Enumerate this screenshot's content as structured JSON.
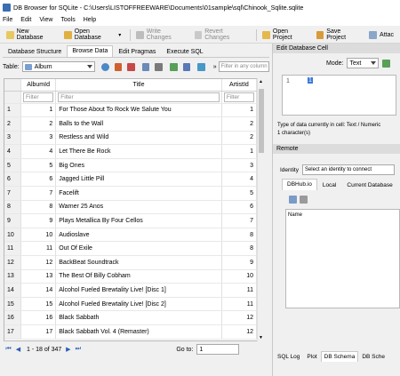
{
  "window": {
    "title": "DB Browser for SQLite - C:\\Users\\LISTOFFREEWARE\\Documents\\01sample\\sql\\Chinook_Sqlite.sqlite"
  },
  "menu": [
    "File",
    "Edit",
    "View",
    "Tools",
    "Help"
  ],
  "toolbar": {
    "new_db": "New Database",
    "open_db": "Open Database",
    "write": "Write Changes",
    "revert": "Revert Changes",
    "open_project": "Open Project",
    "save_project": "Save Project",
    "attach": "Attac"
  },
  "main_tabs": [
    "Database Structure",
    "Browse Data",
    "Edit Pragmas",
    "Execute SQL"
  ],
  "browse": {
    "table_label": "Table:",
    "table_value": "Album",
    "filter_placeholder": "Filter in any column"
  },
  "columns": [
    "AlbumId",
    "Title",
    "ArtistId"
  ],
  "filter_label": "Filter",
  "rows": [
    {
      "n": "1",
      "id": "1",
      "title": "For Those About To Rock We Salute You",
      "artist": "1"
    },
    {
      "n": "2",
      "id": "2",
      "title": "Balls to the Wall",
      "artist": "2"
    },
    {
      "n": "3",
      "id": "3",
      "title": "Restless and Wild",
      "artist": "2"
    },
    {
      "n": "4",
      "id": "4",
      "title": "Let There Be Rock",
      "artist": "1"
    },
    {
      "n": "5",
      "id": "5",
      "title": "Big Ones",
      "artist": "3"
    },
    {
      "n": "6",
      "id": "6",
      "title": "Jagged Little Pill",
      "artist": "4"
    },
    {
      "n": "7",
      "id": "7",
      "title": "Facelift",
      "artist": "5"
    },
    {
      "n": "8",
      "id": "8",
      "title": "Warner 25 Anos",
      "artist": "6"
    },
    {
      "n": "9",
      "id": "9",
      "title": "Plays Metallica By Four Cellos",
      "artist": "7"
    },
    {
      "n": "10",
      "id": "10",
      "title": "Audioslave",
      "artist": "8"
    },
    {
      "n": "11",
      "id": "11",
      "title": "Out Of Exile",
      "artist": "8"
    },
    {
      "n": "12",
      "id": "12",
      "title": "BackBeat Soundtrack",
      "artist": "9"
    },
    {
      "n": "13",
      "id": "13",
      "title": "The Best Of Billy Cobham",
      "artist": "10"
    },
    {
      "n": "14",
      "id": "14",
      "title": "Alcohol Fueled Brewtality Live! [Disc 1]",
      "artist": "11"
    },
    {
      "n": "15",
      "id": "15",
      "title": "Alcohol Fueled Brewtality Live! [Disc 2]",
      "artist": "11"
    },
    {
      "n": "16",
      "id": "16",
      "title": "Black Sabbath",
      "artist": "12"
    },
    {
      "n": "17",
      "id": "17",
      "title": "Black Sabbath Vol. 4 (Remaster)",
      "artist": "12"
    }
  ],
  "footer": {
    "range": "1 - 18 of 347",
    "goto_label": "Go to:",
    "goto_value": "1"
  },
  "edit_cell": {
    "header": "Edit Database Cell",
    "mode_label": "Mode:",
    "mode_value": "Text",
    "line": "1",
    "value": "1",
    "type_info": "Type of data currently in cell: Text / Numeric",
    "size_info": "1 character(s)"
  },
  "remote": {
    "header": "Remote",
    "identity_label": "Identity",
    "identity_value": "Select an identity to connect",
    "tabs": [
      "DBHub.io",
      "Local",
      "Current Database"
    ],
    "name_header": "Name"
  },
  "bottom_tabs": [
    "SQL Log",
    "Plot",
    "DB Schema",
    "DB Sche"
  ]
}
